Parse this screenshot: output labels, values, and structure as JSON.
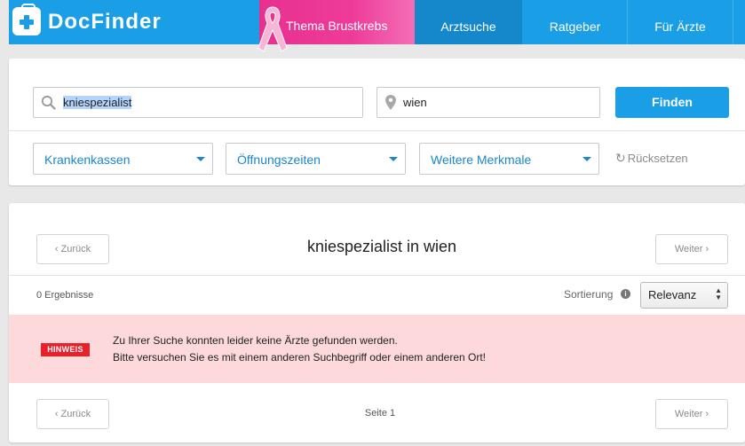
{
  "nav": {
    "brand": "DocFinder",
    "items": [
      {
        "label": "Thema Brustkrebs"
      },
      {
        "label": "Arztsuche",
        "active": true
      },
      {
        "label": "Ratgeber"
      },
      {
        "label": "Für Ärzte"
      }
    ]
  },
  "search": {
    "query": "kniespezialist",
    "location": "wien",
    "submit_label": "Finden"
  },
  "filters": {
    "items": [
      "Krankenkassen",
      "Öffnungszeiten",
      "Weitere Merkmale"
    ],
    "reset_label": "Rücksetzen"
  },
  "results": {
    "heading": "kniespezialist in wien",
    "prev_label": "Zurück",
    "next_label": "Weiter",
    "count_text": "0 Ergebnisse",
    "sort_label": "Sortierung",
    "sort_value": "Relevanz",
    "notice": {
      "badge": "HINWEIS",
      "line1": "Zu Ihrer Suche konnten leider keine Ärzte gefunden werden.",
      "line2": "Bitte versuchen Sie es mit einem anderen Suchbegriff oder einem anderen Ort!"
    },
    "page_label": "Seite 1"
  },
  "colors": {
    "brand_blue": "#1a9ee6",
    "pink": "#ee3b9a",
    "alert_bg": "#fdd9dc",
    "badge_red": "#e8202a"
  }
}
